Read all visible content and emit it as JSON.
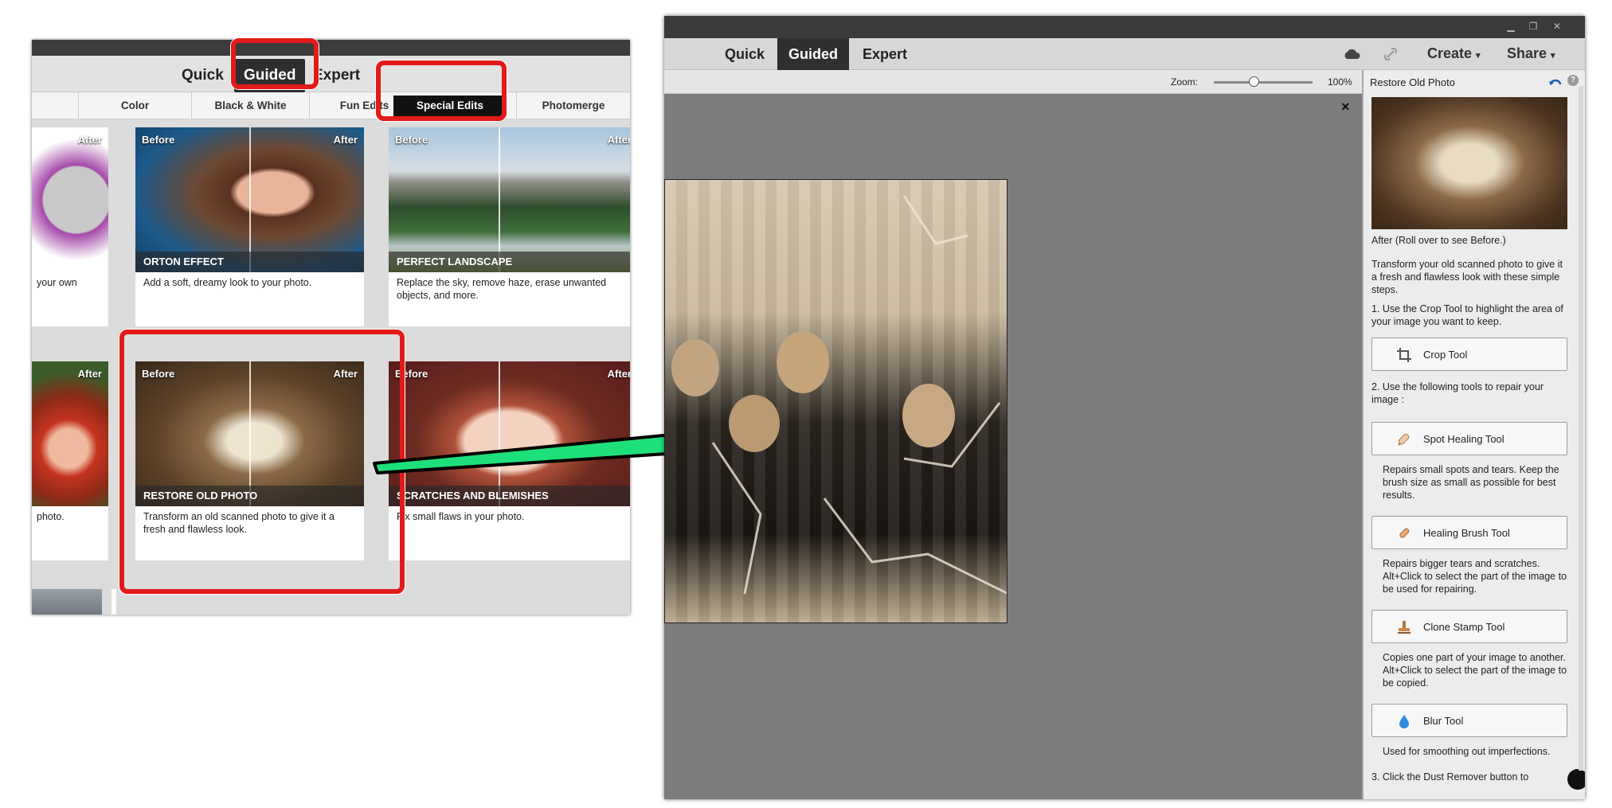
{
  "left_window": {
    "modes": [
      "Quick",
      "Guided",
      "Expert"
    ],
    "tabs": [
      "Color",
      "Black & White",
      "Fun Edits",
      "Special Edits",
      "Photomerge"
    ],
    "before_label": "Before",
    "after_label": "After",
    "cards": [
      {
        "title": "",
        "desc": "your own"
      },
      {
        "title": "ORTON EFFECT",
        "desc": "Add a soft, dreamy look to your photo."
      },
      {
        "title": "PERFECT LANDSCAPE",
        "desc": "Replace the sky, remove haze, erase unwanted objects, and more."
      },
      {
        "title": "",
        "desc": "photo."
      },
      {
        "title": "RESTORE OLD PHOTO",
        "desc": "Transform an old scanned photo to give it a fresh and flawless look."
      },
      {
        "title": "SCRATCHES AND BLEMISHES",
        "desc": "Fix small flaws in your photo."
      }
    ]
  },
  "right_window": {
    "modes": [
      "Quick",
      "Guided",
      "Expert"
    ],
    "create_label": "Create",
    "share_label": "Share",
    "zoom_label": "Zoom:",
    "zoom_value": "100%",
    "zoom_fraction": 0.4,
    "close_glyph": "×",
    "panel": {
      "title": "Restore Old Photo",
      "after_caption": "After (Roll over to see Before.)",
      "intro": "Transform your old scanned photo to give it a fresh and flawless look with these simple steps.",
      "step1": "1. Use the Crop Tool to highlight the area of your image you want to keep.",
      "step2": "2. Use the following tools to repair your image :",
      "tools": [
        {
          "label": "Crop Tool",
          "icon": "crop-icon",
          "desc": ""
        },
        {
          "label": "Spot Healing Tool",
          "icon": "spot-healing-icon",
          "desc": "Repairs small spots and tears. Keep the brush size as small as possible for best results."
        },
        {
          "label": "Healing Brush Tool",
          "icon": "healing-brush-icon",
          "desc": "Repairs bigger tears and scratches. Alt+Click to select the part of the image to be used for repairing."
        },
        {
          "label": "Clone Stamp Tool",
          "icon": "clone-stamp-icon",
          "desc": "Copies one part of your image to another. Alt+Click to select the part of the image to be copied."
        },
        {
          "label": "Blur Tool",
          "icon": "blur-icon",
          "desc": "Used for smoothing out imperfections."
        }
      ],
      "cutoff_text": "3. Click the Dust Remover button to"
    }
  },
  "colors": {
    "highlight": "#e41a1a",
    "arrow": "#1ee07a",
    "dark_bar": "#2f2f2f"
  }
}
